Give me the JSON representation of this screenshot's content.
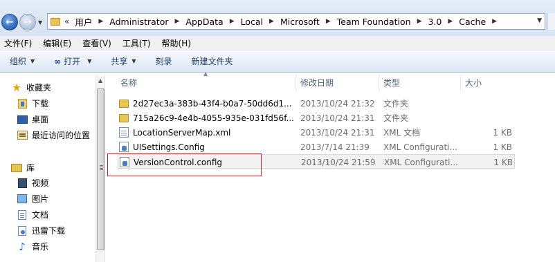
{
  "address": {
    "overflow": "«",
    "crumbs": [
      "用户",
      "Administrator",
      "AppData",
      "Local",
      "Microsoft",
      "Team Foundation",
      "3.0",
      "Cache"
    ]
  },
  "menu": [
    "文件(F)",
    "编辑(E)",
    "查看(V)",
    "工具(T)",
    "帮助(H)"
  ],
  "toolbar": {
    "organize": "组织",
    "open": "打开",
    "share": "共享",
    "burn": "刻录",
    "new_folder": "新建文件夹"
  },
  "nav": {
    "favorites": "收藏夹",
    "downloads": "下载",
    "desktop": "桌面",
    "recent": "最近访问的位置",
    "libraries": "库",
    "videos": "视频",
    "pictures": "图片",
    "documents": "文档",
    "thunder": "迅雷下载",
    "music": "音乐"
  },
  "columns": {
    "name": "名称",
    "date": "修改日期",
    "type": "类型",
    "size": "大小"
  },
  "files": [
    {
      "name": "2d27ec3a-383b-43f4-b0a7-50dd6d1...",
      "date": "2013/10/24 21:32",
      "type": "文件夹",
      "size": "",
      "icon": "folder-icon"
    },
    {
      "name": "715a26c9-4e4b-4055-935e-031fd56f...",
      "date": "2013/10/24 21:31",
      "type": "文件夹",
      "size": "",
      "icon": "folder-icon"
    },
    {
      "name": "LocationServerMap.xml",
      "date": "2013/10/24 21:31",
      "type": "XML 文档",
      "size": "1 KB",
      "icon": "xml-file-icon"
    },
    {
      "name": "UISettings.Config",
      "date": "2013/7/14 21:39",
      "type": "XML Configurati...",
      "size": "1 KB",
      "icon": "config-file-icon"
    },
    {
      "name": "VersionControl.config",
      "date": "2013/10/24 21:59",
      "type": "XML Configurati...",
      "size": "1 KB",
      "icon": "config-file-icon"
    }
  ],
  "colors": {
    "highlight_box": "#e11b22",
    "toolbar_text": "#1e3a5f"
  }
}
